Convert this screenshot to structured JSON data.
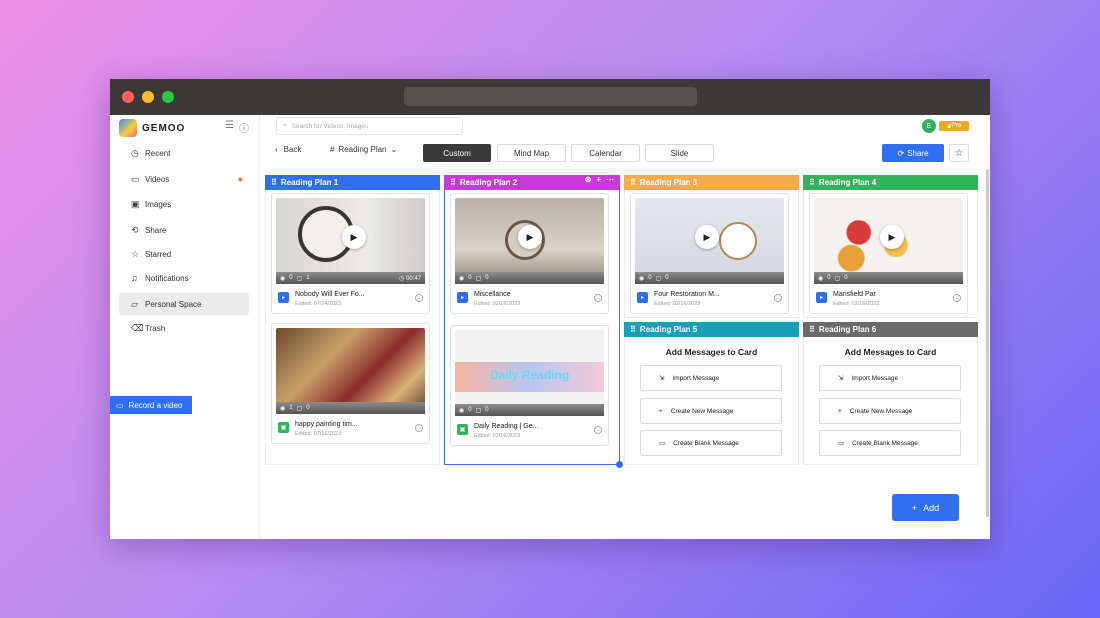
{
  "app": {
    "logo_text": "GEMOO"
  },
  "search": {
    "placeholder": "Search for Videos, Images"
  },
  "user": {
    "avatar_initial": "E",
    "badge": "Pro"
  },
  "sidebar": {
    "items": [
      {
        "label": "Recent",
        "icon": "clock-icon"
      },
      {
        "label": "Videos",
        "icon": "video-icon"
      },
      {
        "label": "Images",
        "icon": "image-icon"
      },
      {
        "label": "Share",
        "icon": "share-icon"
      },
      {
        "label": "Starred",
        "icon": "star-icon"
      },
      {
        "label": "Notifications",
        "icon": "bell-icon"
      },
      {
        "label": "Personal Space",
        "icon": "folder-icon"
      },
      {
        "label": "Trash",
        "icon": "trash-icon"
      }
    ],
    "record_label": "Record a video"
  },
  "toolbar": {
    "back_label": "Back",
    "plan_label": "Reading Plan",
    "views": [
      "Custom",
      "Mind Map",
      "Calendar",
      "Slide"
    ],
    "active_view": "Custom",
    "share_label": "Share"
  },
  "columns": [
    {
      "title": "Reading Plan 1",
      "color": "#2f6ff0"
    },
    {
      "title": "Reading Plan 2",
      "color": "#c73ad8"
    },
    {
      "title": "Reading Plan 3",
      "color": "#f7ab4a"
    },
    {
      "title": "Reading Plan 4",
      "color": "#33b35a"
    },
    {
      "title": "Reading Plan 5",
      "color": "#18a0b8"
    },
    {
      "title": "Reading Plan 6",
      "color": "#6b6b6b"
    }
  ],
  "cards": [
    {
      "title": "Nobody Will Ever Fo...",
      "date": "Edited: 07/24/2023",
      "views": "0",
      "comments": "1",
      "duration": "00:47",
      "type": "video"
    },
    {
      "title": "happy painting tim...",
      "date": "Edited: 07/16/2023",
      "views": "1",
      "comments": "0",
      "type": "image"
    },
    {
      "title": "Miscellance",
      "date": "Edited: 02/16/2023",
      "views": "0",
      "comments": "0",
      "type": "video"
    },
    {
      "title": "Daily Reading | Ge...",
      "date": "Edited: 02/16/2023",
      "views": "0",
      "comments": "0",
      "type": "image",
      "thumb_text": "Daily Reading"
    },
    {
      "title": "Four Restoration M...",
      "date": "Edited: 02/16/2023",
      "views": "0",
      "comments": "0",
      "type": "video"
    },
    {
      "title": "Mansfield Par",
      "date": "Edited: 02/16/2023",
      "views": "0",
      "comments": "0",
      "type": "video"
    }
  ],
  "message_panel": {
    "heading": "Add Messages to Card",
    "buttons": [
      "Import Message",
      "Create New Message",
      "Create Blank Message"
    ]
  },
  "add_label": "Add"
}
